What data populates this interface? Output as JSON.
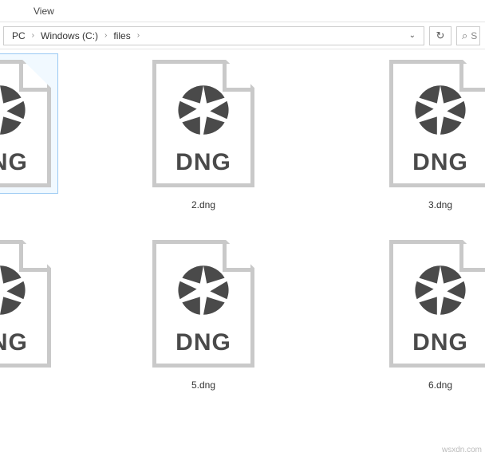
{
  "menu": {
    "view": "View"
  },
  "breadcrumb": {
    "pc": "PC",
    "drive": "Windows (C:)",
    "folder": "files",
    "separator": "›"
  },
  "search": {
    "placeholder": "S"
  },
  "file_ext_label": "DNG",
  "files": [
    {
      "name": ""
    },
    {
      "name": "2.dng"
    },
    {
      "name": "3.dng"
    },
    {
      "name": ""
    },
    {
      "name": "5.dng"
    },
    {
      "name": "6.dng"
    }
  ],
  "watermark": "wsxdn.com"
}
